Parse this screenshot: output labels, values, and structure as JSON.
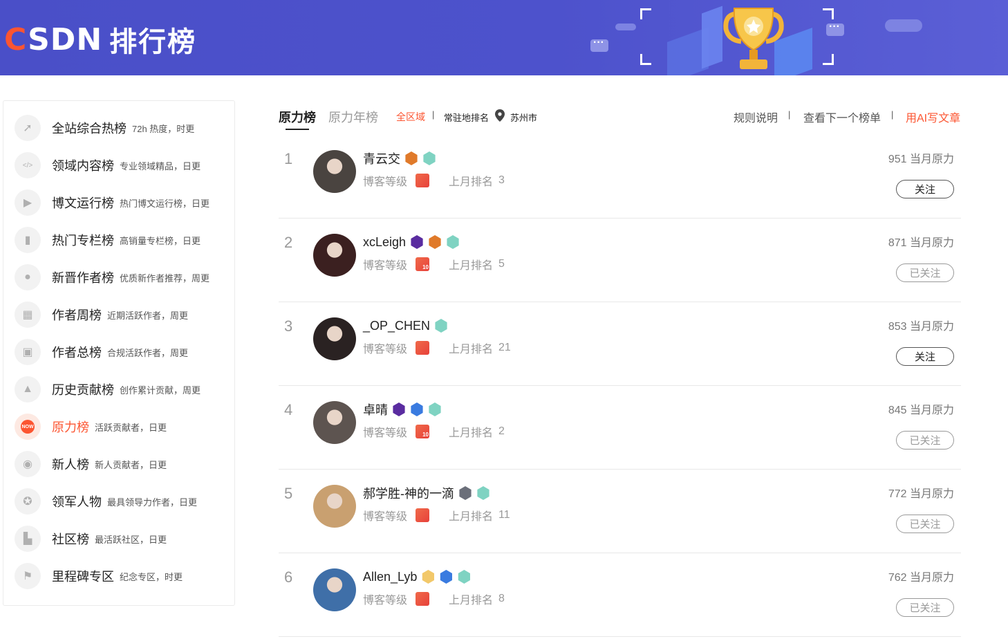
{
  "header": {
    "logo_text": "CSDN",
    "logo_c": "C",
    "logo_rest": "SDN",
    "title": "排行榜"
  },
  "sidebar": {
    "items": [
      {
        "label": "全站综合热榜",
        "desc": "72h 热度，时更",
        "icon": "rocket-icon",
        "glyph": "➚",
        "active": false
      },
      {
        "label": "领域内容榜",
        "desc": "专业领域精品，日更",
        "icon": "code-icon",
        "glyph": "</>",
        "active": false
      },
      {
        "label": "博文运行榜",
        "desc": "热门博文运行榜，日更",
        "icon": "play-icon",
        "glyph": "▶",
        "active": false
      },
      {
        "label": "热门专栏榜",
        "desc": "高销量专栏榜，日更",
        "icon": "book-icon",
        "glyph": "▮",
        "active": false
      },
      {
        "label": "新晋作者榜",
        "desc": "优质新作者推荐，周更",
        "icon": "user-icon",
        "glyph": "●",
        "active": false
      },
      {
        "label": "作者周榜",
        "desc": "近期活跃作者，周更",
        "icon": "calendar-icon",
        "glyph": "▦",
        "active": false
      },
      {
        "label": "作者总榜",
        "desc": "合规活跃作者，周更",
        "icon": "robot-icon",
        "glyph": "▣",
        "active": false
      },
      {
        "label": "历史贡献榜",
        "desc": "创作累计贡献，周更",
        "icon": "builder-icon",
        "glyph": "▲",
        "active": false
      },
      {
        "label": "原力榜",
        "desc": "活跃贡献者，日更",
        "icon": "force-icon",
        "glyph": "NOW",
        "active": true
      },
      {
        "label": "新人榜",
        "desc": "新人贡献者，日更",
        "icon": "newbie-icon",
        "glyph": "◉",
        "active": false
      },
      {
        "label": "领军人物",
        "desc": "最具领导力作者，日更",
        "icon": "medal-icon",
        "glyph": "✪",
        "active": false
      },
      {
        "label": "社区榜",
        "desc": "最活跃社区，日更",
        "icon": "community-icon",
        "glyph": "▙",
        "active": false
      },
      {
        "label": "里程碑专区",
        "desc": "纪念专区，时更",
        "icon": "milestone-icon",
        "glyph": "⚑",
        "active": false
      }
    ]
  },
  "tabs": {
    "active": "原力榜",
    "inactive": "原力年榜"
  },
  "filters": {
    "region": "全区域",
    "sep": "|",
    "resident": "常驻地排名",
    "city": "苏州市"
  },
  "links": {
    "rules": "规则说明",
    "sep": "|",
    "next": "查看下一个榜单",
    "ai": "用AI写文章"
  },
  "colors": {
    "brand": "#fc5531",
    "header": "#4a4fc8"
  },
  "rows": [
    {
      "rank": "1",
      "name": "青云交",
      "badges": [
        "b-orange",
        "b-teal"
      ],
      "level_label": "博客等级",
      "level": "",
      "last_label": "上月排名",
      "last": "3",
      "power": "951 当月原力",
      "follow": "关注",
      "followed": false,
      "avatar": "#4a4440"
    },
    {
      "rank": "2",
      "name": "xcLeigh",
      "badges": [
        "b-purple",
        "b-orange",
        "b-teal"
      ],
      "level_label": "博客等级",
      "level": "10",
      "last_label": "上月排名",
      "last": "5",
      "power": "871 当月原力",
      "follow": "已关注",
      "followed": true,
      "avatar": "#3b2020"
    },
    {
      "rank": "3",
      "name": "_OP_CHEN",
      "badges": [
        "b-teal"
      ],
      "level_label": "博客等级",
      "level": "",
      "last_label": "上月排名",
      "last": "21",
      "power": "853 当月原力",
      "follow": "关注",
      "followed": false,
      "avatar": "#2a2222"
    },
    {
      "rank": "4",
      "name": "卓晴",
      "badges": [
        "b-purple",
        "b-blue",
        "b-teal"
      ],
      "level_label": "博客等级",
      "level": "10",
      "last_label": "上月排名",
      "last": "2",
      "power": "845 当月原力",
      "follow": "已关注",
      "followed": true,
      "avatar": "#5d5450"
    },
    {
      "rank": "5",
      "name": "郝学胜-神的一滴",
      "badges": [
        "b-gray",
        "b-teal"
      ],
      "level_label": "博客等级",
      "level": "",
      "last_label": "上月排名",
      "last": "11",
      "power": "772 当月原力",
      "follow": "已关注",
      "followed": true,
      "avatar": "#c9a070"
    },
    {
      "rank": "6",
      "name": "Allen_Lyb",
      "badges": [
        "b-gold",
        "b-blue",
        "b-teal"
      ],
      "level_label": "博客等级",
      "level": "",
      "last_label": "上月排名",
      "last": "8",
      "power": "762 当月原力",
      "follow": "已关注",
      "followed": true,
      "avatar": "#3f6fa8"
    }
  ]
}
